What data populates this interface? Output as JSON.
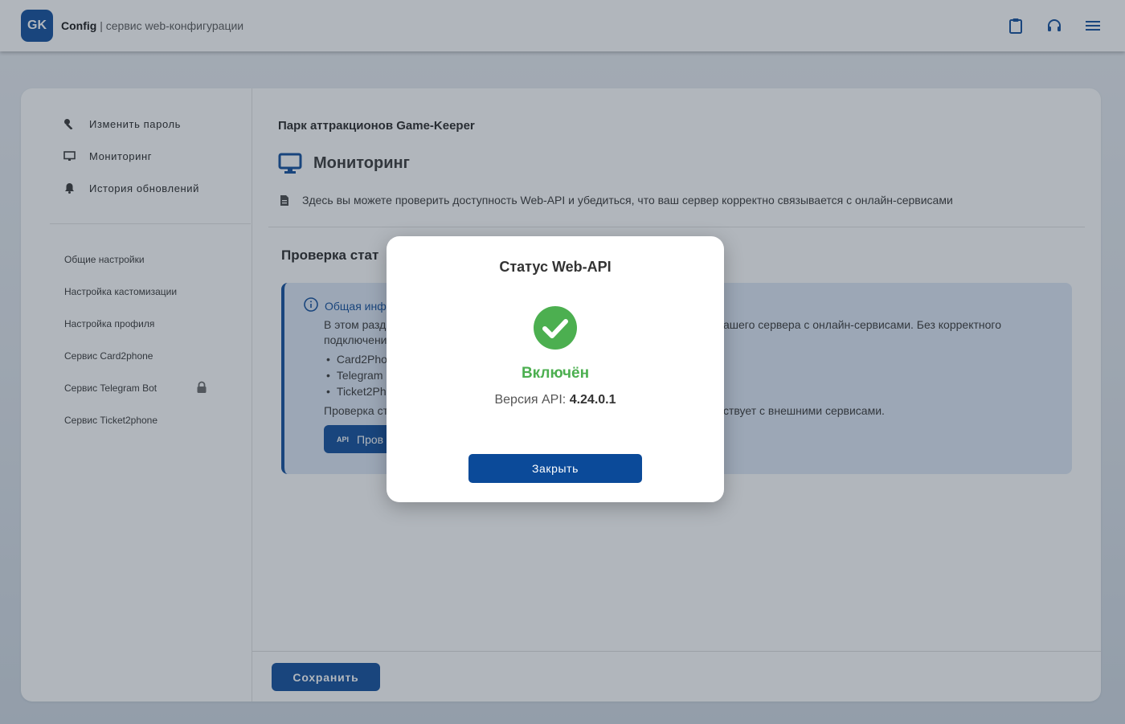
{
  "header": {
    "logo": "GK",
    "app_name": "Config",
    "app_subtitle": " | сервис web-конфигурации",
    "icons": [
      "clipboard-icon",
      "headset-icon",
      "menu-icon"
    ]
  },
  "sidebar": {
    "top_items": [
      {
        "label": "Изменить пароль",
        "icon": "wrench-icon"
      },
      {
        "label": "Мониторинг",
        "icon": "monitor-icon"
      },
      {
        "label": "История обновлений",
        "icon": "bell-icon"
      }
    ],
    "items": [
      {
        "label": "Общие настройки"
      },
      {
        "label": "Настройка кастомизации"
      },
      {
        "label": "Настройка профиля"
      },
      {
        "label": "Сервис Card2phone"
      },
      {
        "label": "Сервис Telegram Bot",
        "locked": true
      },
      {
        "label": "Сервис Ticket2phone"
      }
    ]
  },
  "main": {
    "org_name": "Парк аттракционов Game-Keeper",
    "title": "Мониторинг",
    "description": "Здесь вы можете проверить доступность Web-API и убедиться, что ваш сервер корректно связывается с онлайн-сервисами",
    "section_title": "Проверка стат",
    "info": {
      "heading": "Общая инф",
      "line1_left": "В этом разд",
      "line1_right": "ашего сервера с онлайн-сервисами. Без корректного",
      "line2": "подключени",
      "list": [
        "Card2Pho",
        "Telegram",
        "Ticket2Ph"
      ],
      "line3_left": "Проверка ст",
      "line3_right": "ствует с внешними сервисами.",
      "button_badge": "API",
      "button_label": "Пров"
    },
    "save_label": "Сохранить"
  },
  "modal": {
    "title": "Статус Web-API",
    "status": "Включён",
    "version_label": "Версия API: ",
    "version_value": "4.24.0.1",
    "close_label": "Закрыть",
    "status_color": "#4caf50"
  }
}
